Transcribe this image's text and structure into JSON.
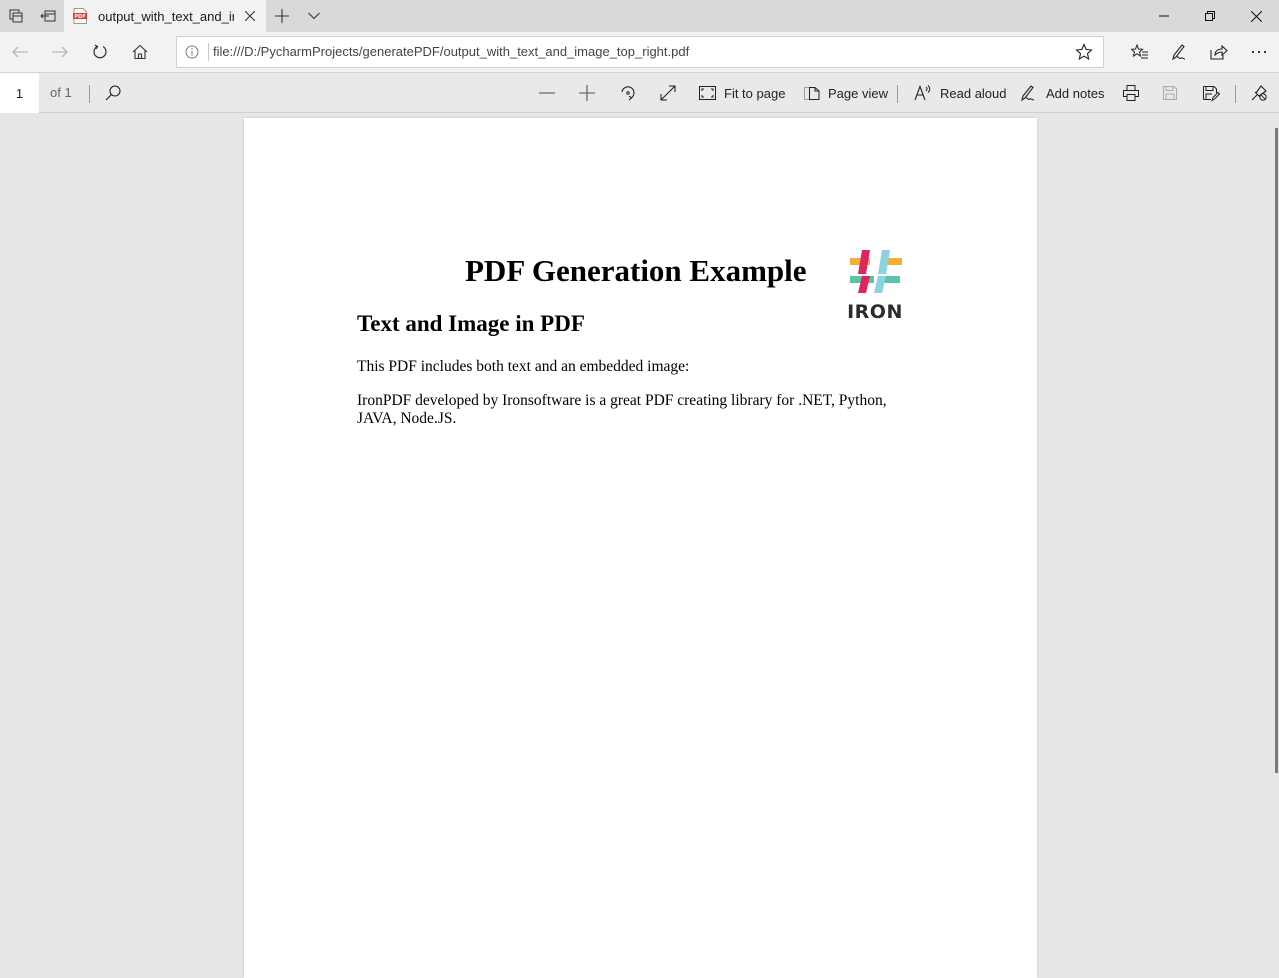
{
  "browser": {
    "tab": {
      "title": "output_with_text_and_ir",
      "icon": "pdf-file-icon"
    },
    "tabstrip_icons": [
      "tab-preview-icon",
      "set-aside-tabs-icon",
      "new-tab-icon",
      "tab-list-chevron-icon"
    ],
    "window_controls": [
      "minimize-icon",
      "restore-icon",
      "close-icon"
    ],
    "address_bar": {
      "url": "file:///D:/PycharmProjects/generatePDF/output_with_text_and_image_top_right.pdf",
      "info_icon": "info-icon",
      "favorite_icon": "star-icon"
    },
    "nav_icons": [
      "back-arrow-icon",
      "forward-arrow-icon",
      "refresh-icon",
      "home-icon"
    ],
    "right_icons": [
      "favorites-list-icon",
      "pen-icon",
      "share-icon",
      "more-icon"
    ]
  },
  "pdf_toolbar": {
    "page_number": "1",
    "page_count": "of 1",
    "fit_to_page": "Fit to page",
    "page_view": "Page view",
    "read_aloud": "Read aloud",
    "add_notes": "Add notes"
  },
  "document": {
    "title": "PDF Generation Example",
    "subtitle": "Text and Image in PDF",
    "paragraph1": "This PDF includes both text and an embedded image:",
    "paragraph2": "IronPDF developed by Ironsoftware is a great PDF creating library for .NET, Python, JAVA, Node.JS.",
    "logo": {
      "text": "IRON",
      "colors": {
        "yellow": "#f2b134",
        "pink": "#e0245e",
        "blue": "#8ad4e2",
        "teal": "#5bc4a6"
      }
    }
  }
}
